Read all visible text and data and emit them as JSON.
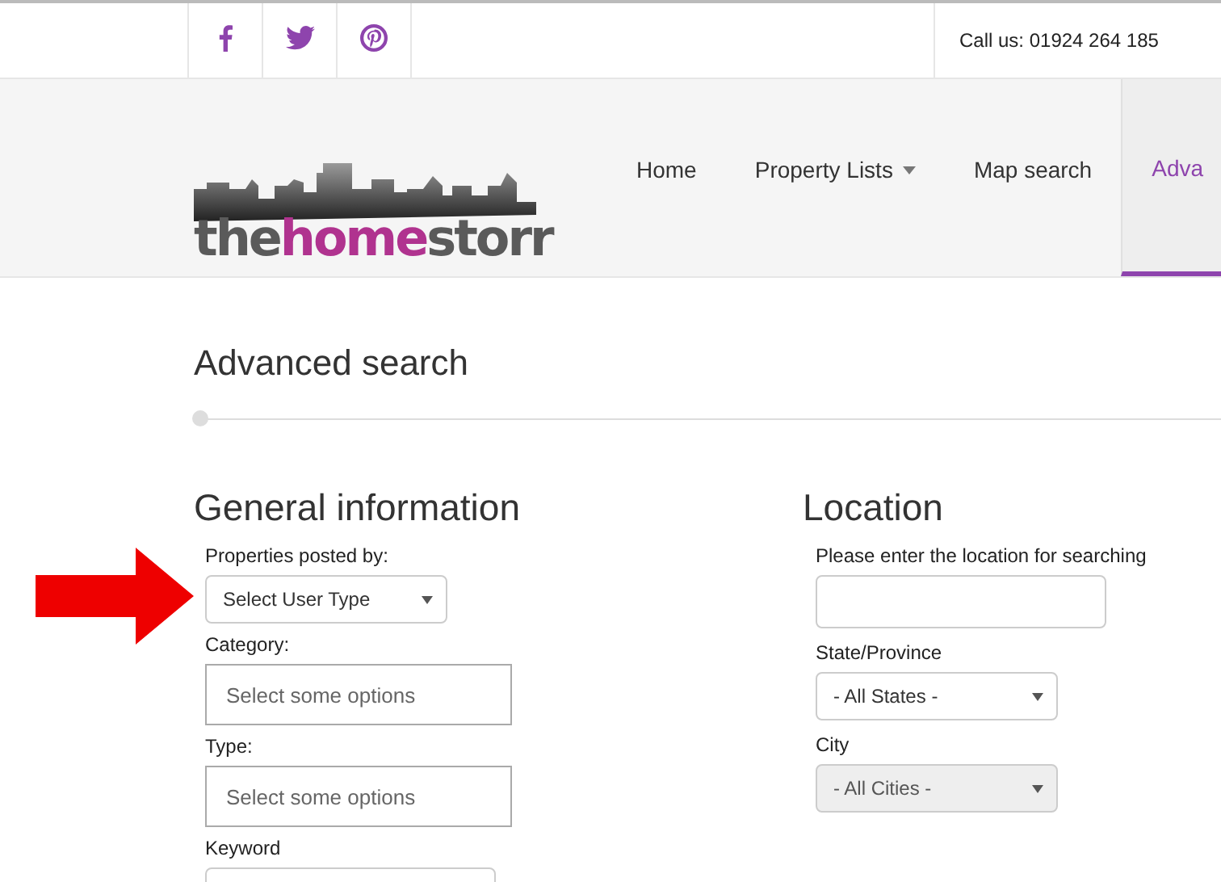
{
  "topbar": {
    "social": [
      {
        "kind": "facebook"
      },
      {
        "kind": "twitter"
      },
      {
        "kind": "pinterest"
      }
    ],
    "phone": "Call us: 01924 264 185"
  },
  "header": {
    "logo": [
      {
        "text": "the",
        "color": "#5a5a5a"
      },
      {
        "text": "home",
        "color": "#b0338f"
      },
      {
        "text": "storr",
        "color": "#5a5a5a"
      }
    ],
    "nav": [
      {
        "label": "Home",
        "dropdown": false,
        "selected": false
      },
      {
        "label": "Property Lists",
        "dropdown": true,
        "selected": false
      },
      {
        "label": "Map search",
        "dropdown": false,
        "selected": false
      },
      {
        "label": "Adva",
        "dropdown": false,
        "selected": true
      }
    ]
  },
  "page_title": "Advanced search",
  "general": {
    "heading": "General information",
    "fields": [
      {
        "kind": "select",
        "label": "Properties posted by:",
        "value": "Select User Type",
        "annotated": true
      },
      {
        "kind": "multiselect",
        "label": "Category:",
        "placeholder": "Select some options"
      },
      {
        "kind": "multiselect",
        "label": "Type:",
        "placeholder": "Select some options"
      },
      {
        "kind": "text",
        "label": "Keyword"
      }
    ]
  },
  "location": {
    "heading": "Location",
    "fields": [
      {
        "kind": "text",
        "label": "Please enter the location for searching"
      },
      {
        "kind": "select",
        "label": "State/Province",
        "value": "- All States -",
        "disabled": false
      },
      {
        "kind": "select",
        "label": "City",
        "value": "- All Cities -",
        "disabled": true
      }
    ]
  }
}
